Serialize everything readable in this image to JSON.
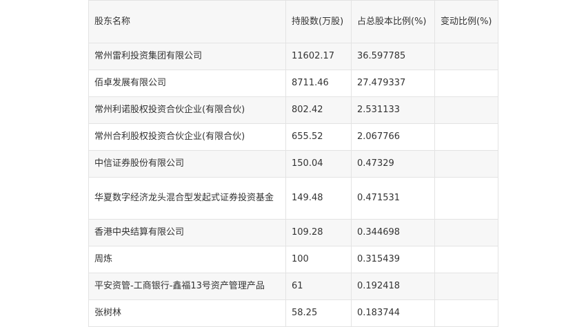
{
  "table": {
    "headers": [
      "股东名称",
      "持股数(万股)",
      "占总股本比例(%)",
      "变动比例(%)"
    ],
    "rows": [
      [
        "常州雷利投资集团有限公司",
        "11602.17",
        "36.597785",
        ""
      ],
      [
        "佰卓发展有限公司",
        "8711.46",
        "27.479337",
        ""
      ],
      [
        "常州利诺股权投资合伙企业(有限合伙)",
        "802.42",
        "2.531133",
        ""
      ],
      [
        "常州合利股权投资合伙企业(有限合伙)",
        "655.52",
        "2.067766",
        ""
      ],
      [
        "中信证券股份有限公司",
        "150.04",
        "0.47329",
        ""
      ],
      [
        "华夏数字经济龙头混合型发起式证券投资基金",
        "149.48",
        "0.471531",
        ""
      ],
      [
        "香港中央结算有限公司",
        "109.28",
        "0.344698",
        ""
      ],
      [
        "周炼",
        "100",
        "0.315439",
        ""
      ],
      [
        "平安资管-工商银行-鑫福13号资产管理产品",
        "61",
        "0.192418",
        ""
      ],
      [
        "张树林",
        "58.25",
        "0.183744",
        ""
      ]
    ]
  }
}
